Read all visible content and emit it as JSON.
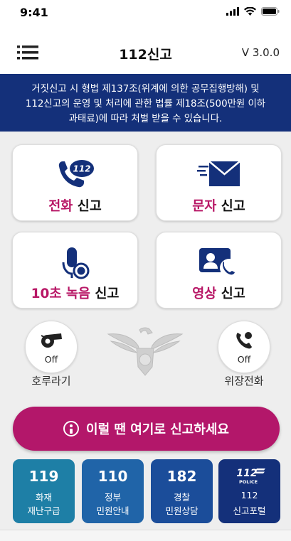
{
  "status_bar": {
    "time": "9:41",
    "icons": [
      "signal-icon",
      "wifi-icon",
      "battery-icon"
    ]
  },
  "header": {
    "title": "112신고",
    "version": "V 3.0.0",
    "menu_icon": "hamburger-menu-icon"
  },
  "notice": {
    "line1": "거짓신고 시 형법 제137조(위계에 의한 공무집행방해) 및",
    "line2": "112신고의 운영 및 처리에 관한 법률 제18조(500만원 이하",
    "line3": "과태료)에 따라 처벌 받을 수 있습니다."
  },
  "report_buttons": [
    {
      "accent": "전화",
      "rest": " 신고",
      "icon": "phone-112-icon"
    },
    {
      "accent": "문자",
      "rest": " 신고",
      "icon": "envelope-icon"
    },
    {
      "accent": "10초 녹음",
      "rest": " 신고",
      "icon": "microphone-icon"
    },
    {
      "accent": "영상",
      "rest": " 신고",
      "icon": "video-call-icon"
    }
  ],
  "toggles": [
    {
      "state": "Off",
      "caption": "호루라기",
      "icon": "whistle-icon"
    },
    {
      "state": "Off",
      "caption": "위장전화",
      "icon": "phone-handset-icon"
    }
  ],
  "emblem_icon": "police-eagle-emblem-icon",
  "cta": {
    "label": "이럴 땐 여기로 신고하세요",
    "icon": "info-circle-icon"
  },
  "hotlines": [
    {
      "number": "119",
      "line1": "화재",
      "line2": "재난구급",
      "color": "#1e7fa6"
    },
    {
      "number": "110",
      "line1": "정부",
      "line2": "민원안내",
      "color": "#2064a8"
    },
    {
      "number": "182",
      "line1": "경찰",
      "line2": "민원상담",
      "color": "#1b4d9a"
    },
    {
      "logo_text": "112",
      "logo_sub": "POLICE",
      "line1": "112",
      "line2": "신고포털",
      "color": "#14307a"
    }
  ],
  "colors": {
    "accent": "#b81766",
    "navy": "#14307a",
    "cta": "#b3176a"
  }
}
